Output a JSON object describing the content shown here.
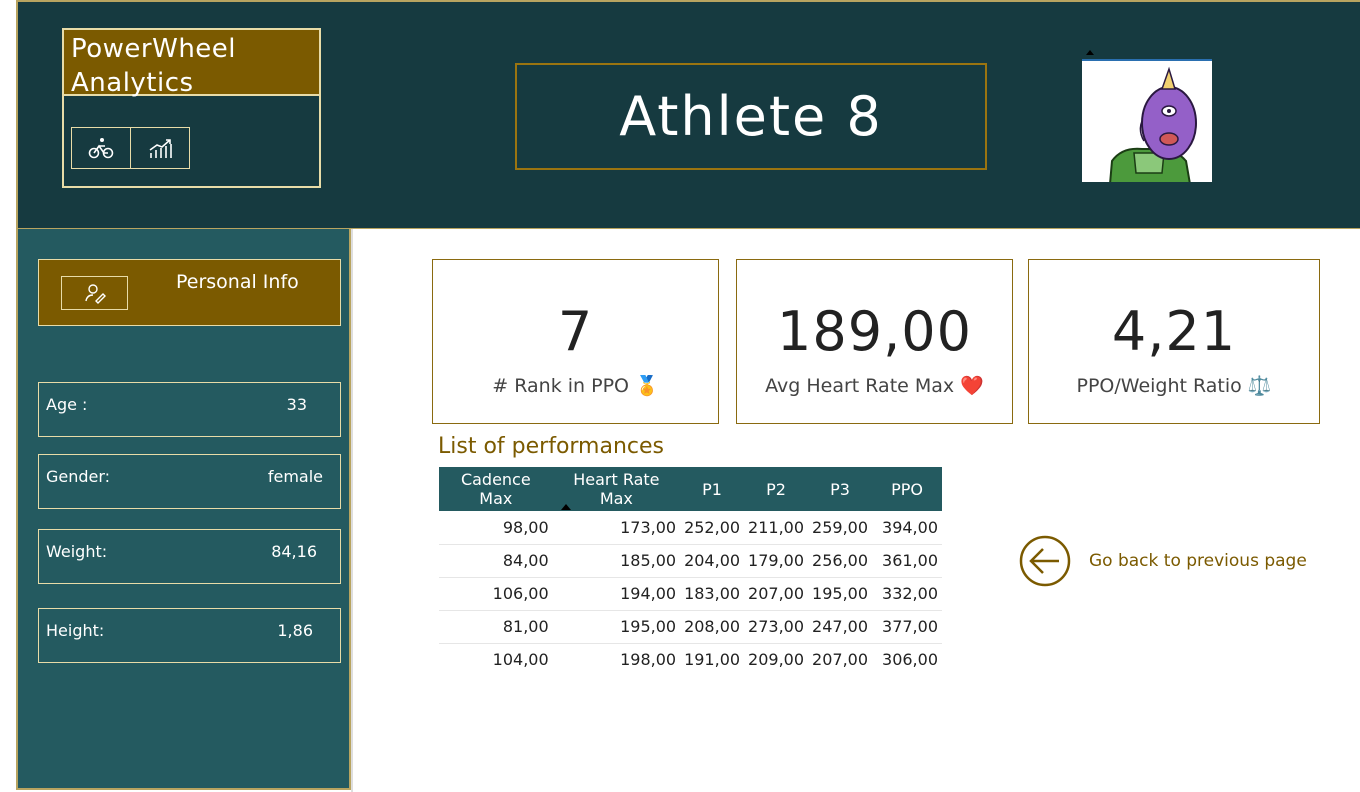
{
  "header": {
    "app_title": "PowerWheel Analytics",
    "athlete_name": "Athlete 8",
    "nav_icons": [
      "bike-icon",
      "chart-icon"
    ],
    "avatar_icon": "monster-avatar-icon"
  },
  "sidebar": {
    "section_label": "Personal Info",
    "section_icon": "edit-person-icon",
    "fields": [
      {
        "key": "Age :",
        "value": "33"
      },
      {
        "key": "Gender:",
        "value": "female"
      },
      {
        "key": "Weight:",
        "value": "84,16"
      },
      {
        "key": "Height:",
        "value": "1,86"
      }
    ]
  },
  "kpis": [
    {
      "value": "7",
      "label": "# Rank in PPO 🏅"
    },
    {
      "value": "189,00",
      "label": "Avg Heart Rate Max ❤️"
    },
    {
      "value": "4,21",
      "label": "PPO/Weight Ratio ⚖️"
    }
  ],
  "performances": {
    "title": "List of performances",
    "columns": [
      "Cadence Max",
      "Heart Rate Max",
      "P1",
      "P2",
      "P3",
      "PPO"
    ],
    "sorted_column": "Heart Rate Max",
    "rows": [
      [
        "98,00",
        "173,00",
        "252,00",
        "211,00",
        "259,00",
        "394,00"
      ],
      [
        "84,00",
        "185,00",
        "204,00",
        "179,00",
        "256,00",
        "361,00"
      ],
      [
        "106,00",
        "194,00",
        "183,00",
        "207,00",
        "195,00",
        "332,00"
      ],
      [
        "81,00",
        "195,00",
        "208,00",
        "273,00",
        "247,00",
        "377,00"
      ],
      [
        "104,00",
        "198,00",
        "191,00",
        "209,00",
        "207,00",
        "306,00"
      ]
    ]
  },
  "navigation": {
    "back_label": "Go back to previous page",
    "back_icon": "arrow-left-circle-icon"
  },
  "colors": {
    "header_bg": "#163a40",
    "sidebar_bg": "#245a60",
    "accent_gold": "#7b5a00"
  }
}
